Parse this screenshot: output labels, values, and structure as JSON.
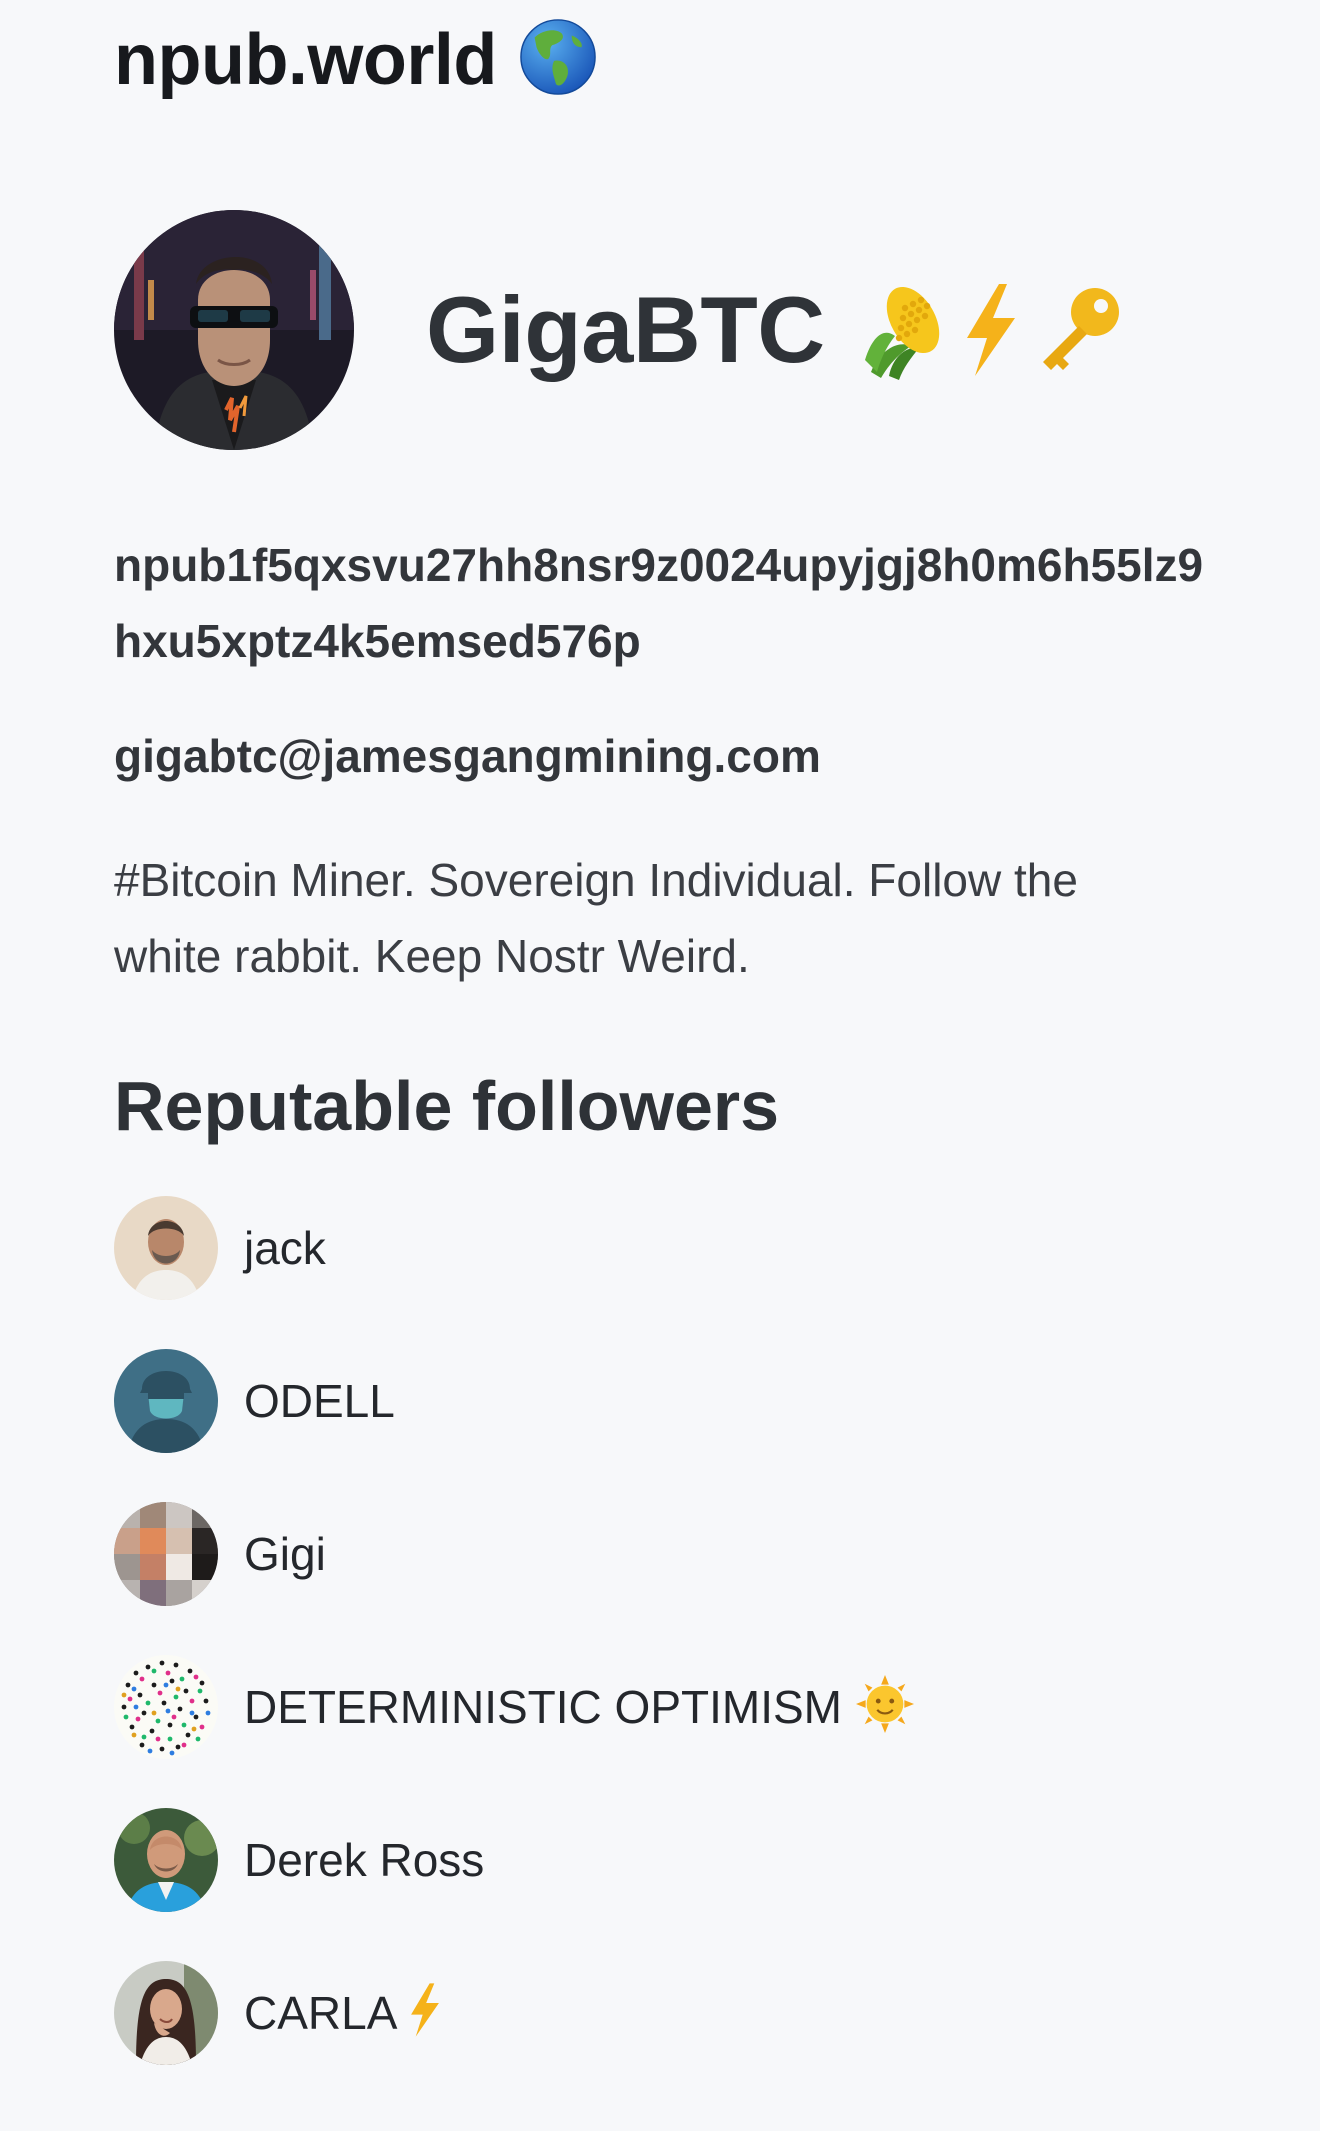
{
  "site": {
    "title": "npub.world",
    "globe_icon": "globe-americas-icon"
  },
  "profile": {
    "display_name": "GigaBTC",
    "name_emojis": [
      "corn-icon",
      "lightning-icon",
      "key-icon"
    ],
    "npub": "npub1f5qxsvu27hh8nsr9z0024upyjgj8h0m6h55lz9hxu5xptz4k5emsed576p",
    "nip05": "gigabtc@jamesgangmining.com",
    "about": "#Bitcoin Miner. Sovereign Individual. Follow the white rabbit. Keep Nostr Weird."
  },
  "followers_section": {
    "title": "Reputable followers",
    "items": [
      {
        "name": "jack",
        "emoji": null
      },
      {
        "name": "ODELL",
        "emoji": null
      },
      {
        "name": "Gigi",
        "emoji": null
      },
      {
        "name": "DETERMINISTIC OPTIMISM",
        "emoji": "sun-with-face-icon"
      },
      {
        "name": "Derek Ross",
        "emoji": null
      },
      {
        "name": "CARLA",
        "emoji": "lightning-icon"
      }
    ]
  },
  "colors": {
    "background": "#f7f8fa",
    "text": "#2d3139",
    "lightning": "#f5b21a",
    "odell_avatar": "#3f6f86"
  }
}
